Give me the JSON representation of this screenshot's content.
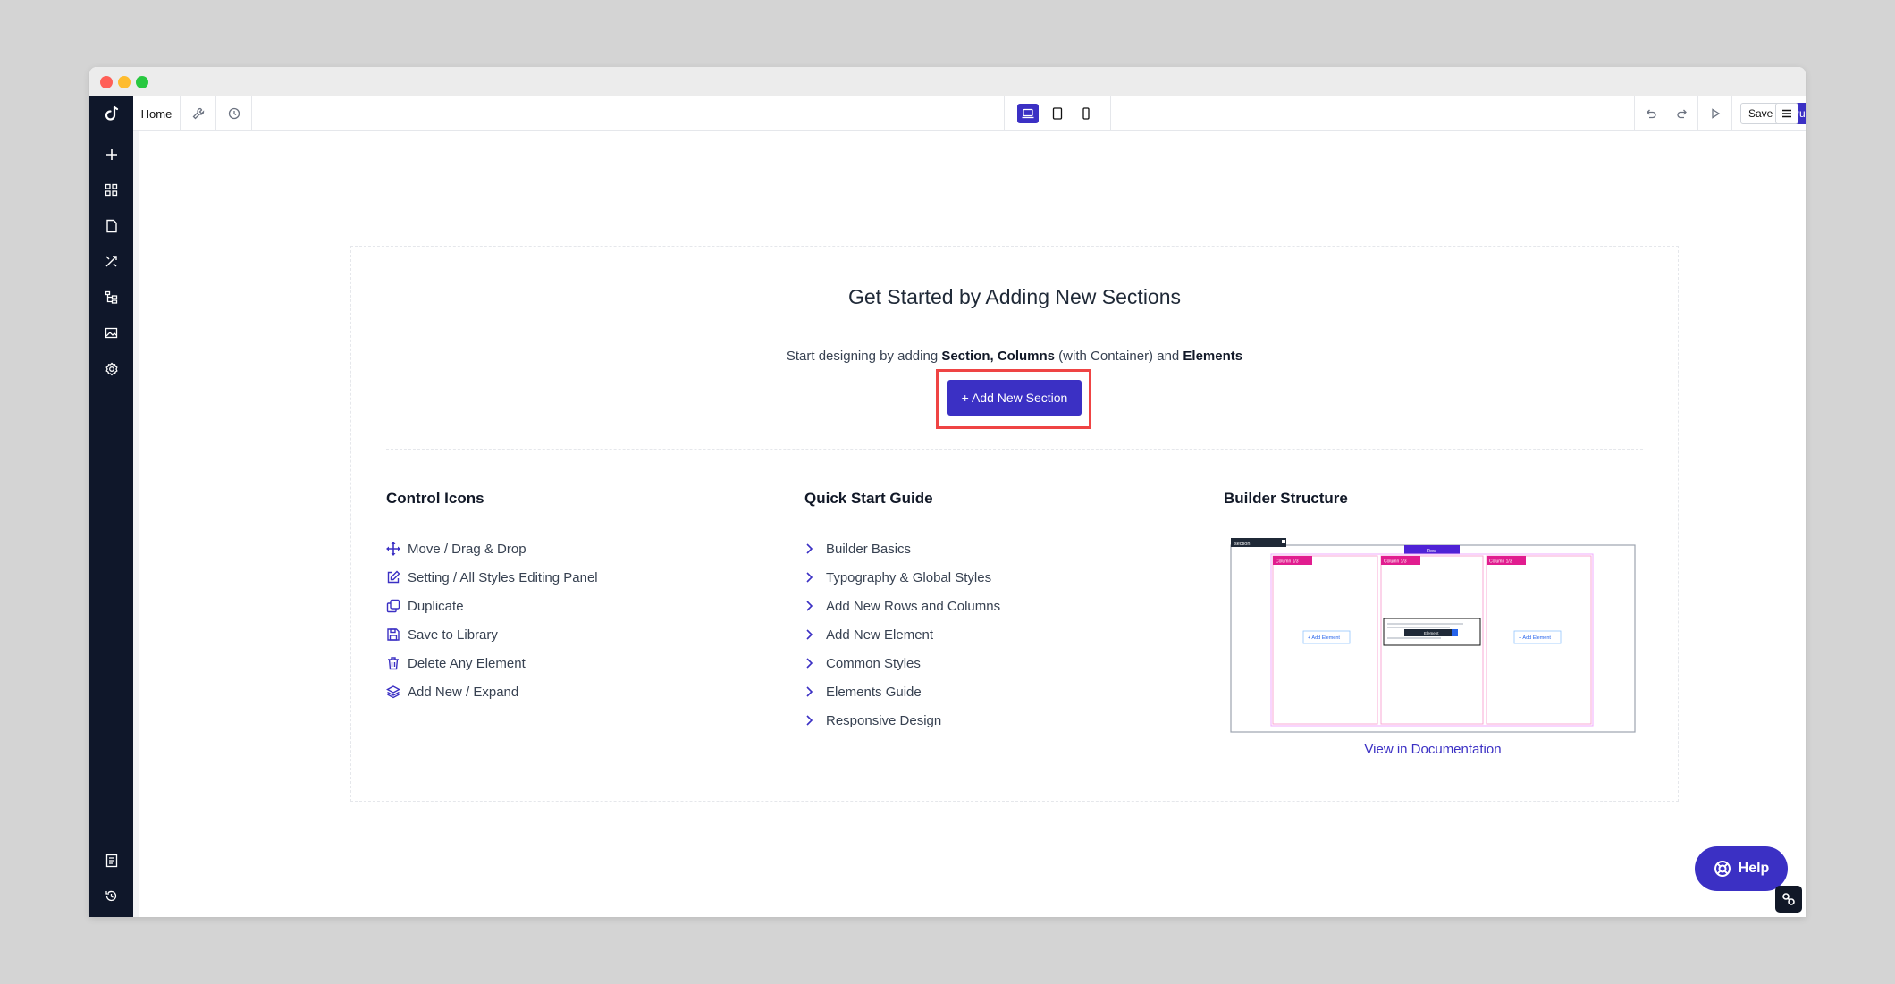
{
  "window": {
    "colors": {
      "accent": "#3b30c4",
      "highlight": "#ef4444",
      "sidebar": "#0f172a"
    }
  },
  "topbar": {
    "home_tab": "Home",
    "save_label": "Save",
    "publish_label": "Publish"
  },
  "sidebar": {
    "icons": [
      "plus-icon",
      "grid-icon",
      "page-icon",
      "tools-icon",
      "structure-icon",
      "image-icon",
      "settings-icon",
      "notes-icon",
      "history-icon"
    ]
  },
  "hero": {
    "title": "Get Started by Adding New Sections",
    "subtitle_prefix": "Start designing by adding ",
    "subtitle_bold1": "Section, Columns",
    "subtitle_mid": " (with Container) and ",
    "subtitle_bold2": "Elements",
    "add_button": "+ Add New Section"
  },
  "control_icons": {
    "title": "Control Icons",
    "items": [
      {
        "label": "Move / Drag & Drop",
        "icon": "move-icon"
      },
      {
        "label": "Setting / All Styles Editing Panel",
        "icon": "edit-icon"
      },
      {
        "label": "Duplicate",
        "icon": "duplicate-icon"
      },
      {
        "label": "Save to Library",
        "icon": "save-icon"
      },
      {
        "label": "Delete Any Element",
        "icon": "trash-icon"
      },
      {
        "label": "Add New / Expand",
        "icon": "layers-icon"
      }
    ]
  },
  "quick_start": {
    "title": "Quick Start Guide",
    "items": [
      "Builder Basics",
      "Typography & Global Styles",
      "Add New Rows and Columns",
      "Add New Element",
      "Common Styles",
      "Elements Guide",
      "Responsive Design"
    ]
  },
  "builder_structure": {
    "title": "Builder Structure",
    "section_tag": "section",
    "row_tag": "Row",
    "column_tags": [
      "Column 1/3",
      "Column 1/3",
      "Column 1/3"
    ],
    "add_element": "+ Add Element",
    "element_tag": "Element",
    "doc_link": "View in Documentation"
  },
  "help": {
    "label": "Help"
  }
}
